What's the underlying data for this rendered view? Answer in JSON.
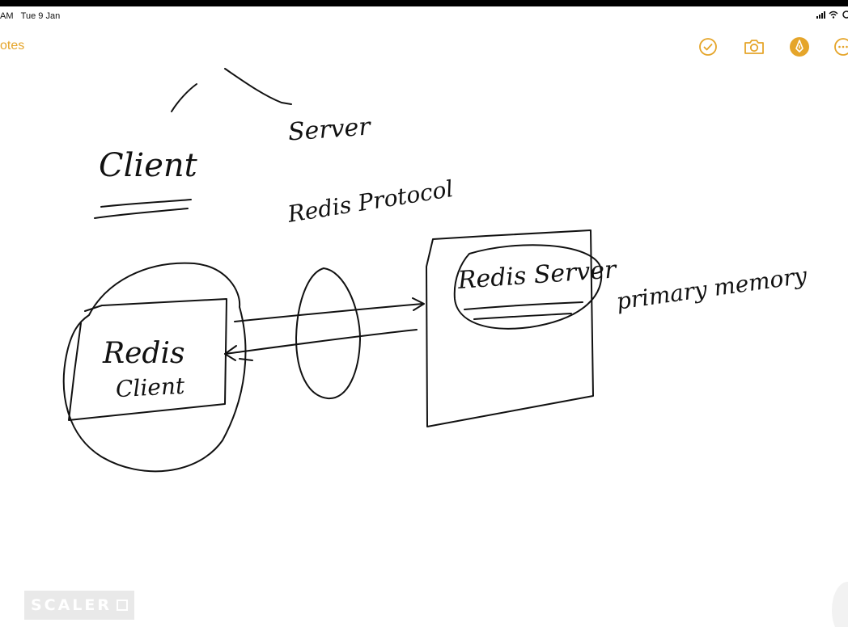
{
  "status_bar": {
    "time": "AM",
    "date": "Tue 9 Jan"
  },
  "nav": {
    "back_label": "otes",
    "accent_color": "#e5a52a",
    "icons": [
      "checkmark-circle-icon",
      "camera-icon",
      "markup-pen-icon",
      "more-ellipsis-icon"
    ]
  },
  "note": {
    "labels": {
      "client": "Client",
      "server": "Server",
      "protocol": "Redis Protocol",
      "redis_server": "Redis Server",
      "redis": "Redis",
      "client_small": "Client",
      "primary_memory": "primary memory"
    }
  },
  "watermark": {
    "text": "SCALER"
  }
}
